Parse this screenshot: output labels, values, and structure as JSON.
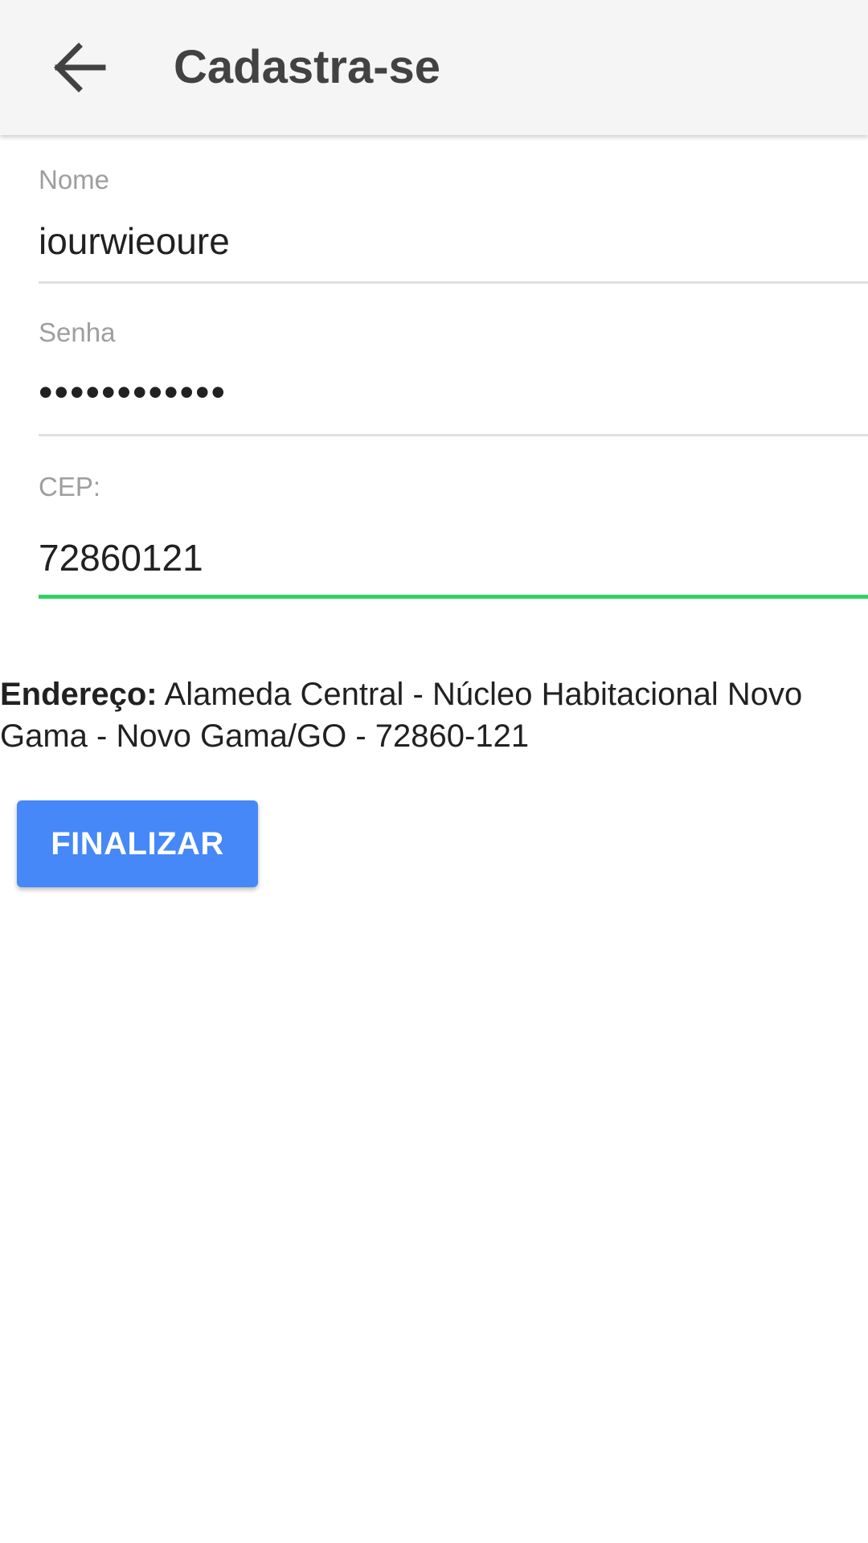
{
  "app_bar": {
    "title": "Cadastra-se",
    "back_icon": "arrow-left-icon"
  },
  "form": {
    "name": {
      "label": "Nome",
      "value": "iourwieoure"
    },
    "password": {
      "label": "Senha",
      "value": "••••••••••••"
    },
    "cep": {
      "label": "CEP:",
      "value": "72860121"
    }
  },
  "address": {
    "label": "Endereço:",
    "value": "Alameda Central - Núcleo Habitacional Novo Gama - Novo Gama/GO - 72860-121"
  },
  "finish_button": {
    "label": "FINALIZAR"
  },
  "colors": {
    "accent": "#4688f7",
    "focused_underline": "#2ed264",
    "app_bar_bg": "#f5f5f5"
  }
}
